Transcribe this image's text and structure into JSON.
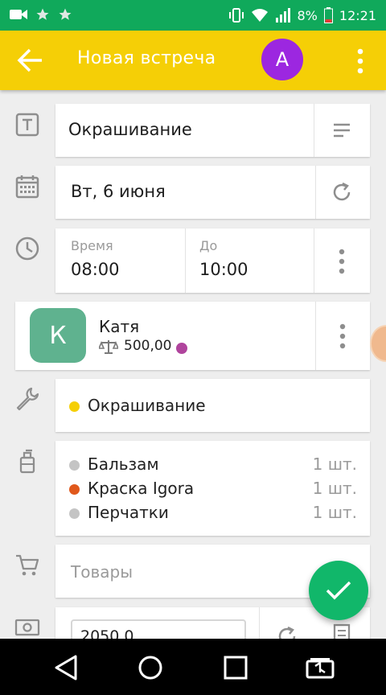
{
  "statusbar": {
    "battery": "8%",
    "time": "12:21"
  },
  "toolbar": {
    "title": "Новая встреча",
    "avatar_letter": "A",
    "avatar_color": "#9c27e0",
    "bg_color": "#f5cf06"
  },
  "service_name": "Окрашивание",
  "date": "Вт, 6 июня",
  "time": {
    "from_label": "Время",
    "from_value": "08:00",
    "to_label": "До",
    "to_value": "10:00"
  },
  "client": {
    "initial": "К",
    "name": "Катя",
    "balance": "500,00",
    "avatar_color": "#5fb28f"
  },
  "services": [
    {
      "name": "Окрашивание",
      "color": "#f5cf06"
    }
  ],
  "materials": [
    {
      "name": "Бальзам",
      "qty": "1 шт.",
      "color": "#c4c4c4"
    },
    {
      "name": "Краска Igora",
      "qty": "1 шт.",
      "color": "#e0581b"
    },
    {
      "name": "Перчатки",
      "qty": "1 шт.",
      "color": "#c4c4c4"
    }
  ],
  "goods_placeholder": "Товары",
  "price_value": "2050,0",
  "accent_color": "#11b76a"
}
